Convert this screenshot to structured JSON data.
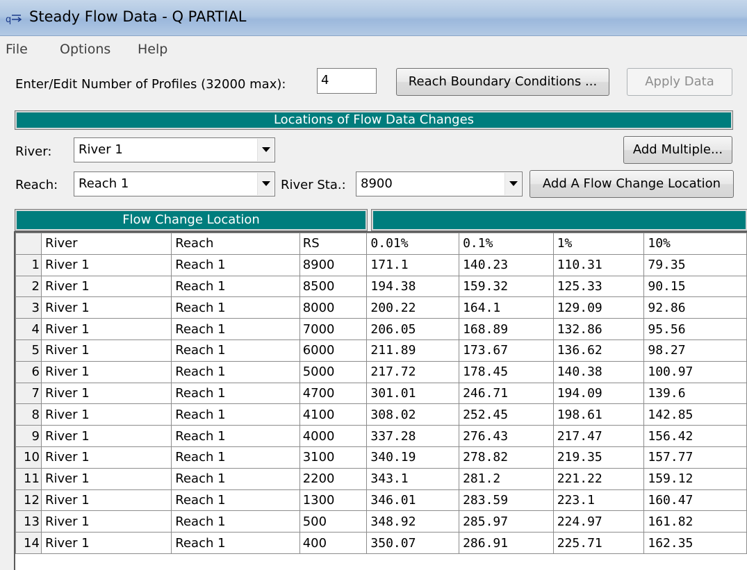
{
  "window": {
    "title": "Steady Flow Data - Q PARTIAL"
  },
  "menu": [
    "File",
    "Options",
    "Help"
  ],
  "profiles": {
    "label": "Enter/Edit Number of Profiles (32000 max):",
    "value": "4"
  },
  "buttons": {
    "reach_boundary": "Reach Boundary Conditions ...",
    "apply_data": "Apply Data",
    "add_multiple": "Add Multiple...",
    "add_flow_change": "Add A Flow Change Location"
  },
  "locations_header": "Locations of Flow Data Changes",
  "river": {
    "label": "River:",
    "value": "River 1"
  },
  "reach": {
    "label": "Reach:",
    "value": "Reach 1"
  },
  "river_sta": {
    "label": "River Sta.:",
    "value": "8900"
  },
  "table": {
    "group_header": "Flow Change Location",
    "columns": [
      "River",
      "Reach",
      "RS",
      "0.01%",
      "0.1%",
      "1%",
      "10%"
    ],
    "rows": [
      {
        "n": "1",
        "river": "River 1",
        "reach": "Reach 1",
        "rs": "8900",
        "v": [
          "171.1",
          "140.23",
          "110.31",
          "79.35"
        ]
      },
      {
        "n": "2",
        "river": "River 1",
        "reach": "Reach 1",
        "rs": "8500",
        "v": [
          "194.38",
          "159.32",
          "125.33",
          "90.15"
        ]
      },
      {
        "n": "3",
        "river": "River 1",
        "reach": "Reach 1",
        "rs": "8000",
        "v": [
          "200.22",
          "164.1",
          "129.09",
          "92.86"
        ]
      },
      {
        "n": "4",
        "river": "River 1",
        "reach": "Reach 1",
        "rs": "7000",
        "v": [
          "206.05",
          "168.89",
          "132.86",
          "95.56"
        ]
      },
      {
        "n": "5",
        "river": "River 1",
        "reach": "Reach 1",
        "rs": "6000",
        "v": [
          "211.89",
          "173.67",
          "136.62",
          "98.27"
        ]
      },
      {
        "n": "6",
        "river": "River 1",
        "reach": "Reach 1",
        "rs": "5000",
        "v": [
          "217.72",
          "178.45",
          "140.38",
          "100.97"
        ]
      },
      {
        "n": "7",
        "river": "River 1",
        "reach": "Reach 1",
        "rs": "4700",
        "v": [
          "301.01",
          "246.71",
          "194.09",
          "139.6"
        ]
      },
      {
        "n": "8",
        "river": "River 1",
        "reach": "Reach 1",
        "rs": "4100",
        "v": [
          "308.02",
          "252.45",
          "198.61",
          "142.85"
        ]
      },
      {
        "n": "9",
        "river": "River 1",
        "reach": "Reach 1",
        "rs": "4000",
        "v": [
          "337.28",
          "276.43",
          "217.47",
          "156.42"
        ]
      },
      {
        "n": "10",
        "river": "River 1",
        "reach": "Reach 1",
        "rs": "3100",
        "v": [
          "340.19",
          "278.82",
          "219.35",
          "157.77"
        ]
      },
      {
        "n": "11",
        "river": "River 1",
        "reach": "Reach 1",
        "rs": "2200",
        "v": [
          "343.1",
          "281.2",
          "221.22",
          "159.12"
        ]
      },
      {
        "n": "12",
        "river": "River 1",
        "reach": "Reach 1",
        "rs": "1300",
        "v": [
          "346.01",
          "283.59",
          "223.1",
          "160.47"
        ]
      },
      {
        "n": "13",
        "river": "River 1",
        "reach": "Reach 1",
        "rs": "500",
        "v": [
          "348.92",
          "285.97",
          "224.97",
          "161.82"
        ]
      },
      {
        "n": "14",
        "river": "River 1",
        "reach": "Reach 1",
        "rs": "400",
        "v": [
          "350.07",
          "286.91",
          "225.71",
          "162.35"
        ]
      }
    ]
  },
  "colors": {
    "banner": "#007d7d",
    "titlebar": "#aec6e2"
  },
  "icons": {
    "title": "flow-data-icon",
    "dropdown": "chevron-down-icon"
  }
}
